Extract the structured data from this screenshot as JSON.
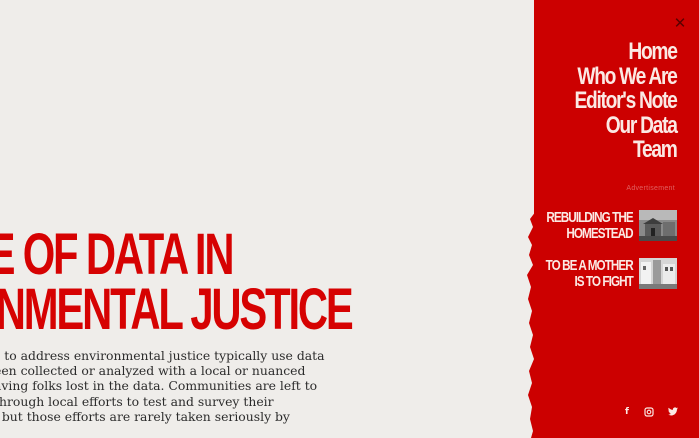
{
  "article": {
    "headline_line1": "ROLE OF DATA IN",
    "headline_line2": "ENVIRONMENTAL JUSTICE",
    "body_lines": [
      "s to address environmental justice typically use data",
      "een collected or analyzed with a local or nuanced",
      "aving folks lost in the data. Communities are left to",
      " through local efforts to test and survey their",
      ", but those efforts are rarely taken seriously by"
    ]
  },
  "menu": {
    "close_icon": "close-icon",
    "nav": [
      "Home",
      "Who We Are",
      "Editor's Note",
      "Our Data",
      "Team"
    ],
    "ad_label": "Advertisement",
    "promos": [
      {
        "title_lines": [
          "REBUILDING THE",
          "HOMESTEAD"
        ],
        "thumb": "house-photo"
      },
      {
        "title_lines": [
          "TO BE A MOTHER",
          "IS TO FIGHT"
        ],
        "thumb": "street-photo"
      }
    ],
    "social": [
      "facebook-icon",
      "instagram-icon",
      "twitter-icon"
    ]
  },
  "colors": {
    "background": "#efedea",
    "accent_red": "#cc0000",
    "headline_red": "#d60202",
    "menu_text": "#fbe9e4"
  }
}
